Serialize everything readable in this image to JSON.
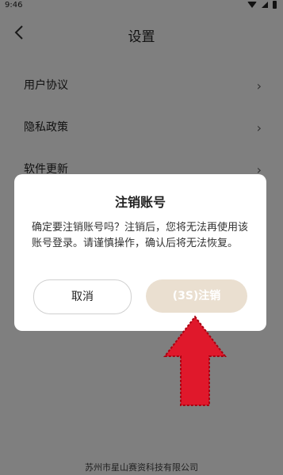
{
  "statusbar": {
    "time": "9:46"
  },
  "header": {
    "title": "设置"
  },
  "menu": {
    "items": [
      {
        "label": "用户协议"
      },
      {
        "label": "隐私政策"
      },
      {
        "label": "软件更新"
      }
    ]
  },
  "footer": {
    "company": "苏州市星山赛资科技有限公司"
  },
  "dialog": {
    "title": "注销账号",
    "message": "确定要注销账号吗？注销后，您将无法再使用该账号登录。请谨慎操作，确认后将无法恢复。",
    "cancel_label": "取消",
    "confirm_label": "(3S)注销"
  },
  "colors": {
    "confirm_button_bg": "#eadfd0",
    "arrow_red": "#e0182b"
  },
  "icons": {
    "back": "chevron-left-icon",
    "menu_chevron": "chevron-right-icon",
    "arrow": "red-up-arrow-annotation"
  }
}
